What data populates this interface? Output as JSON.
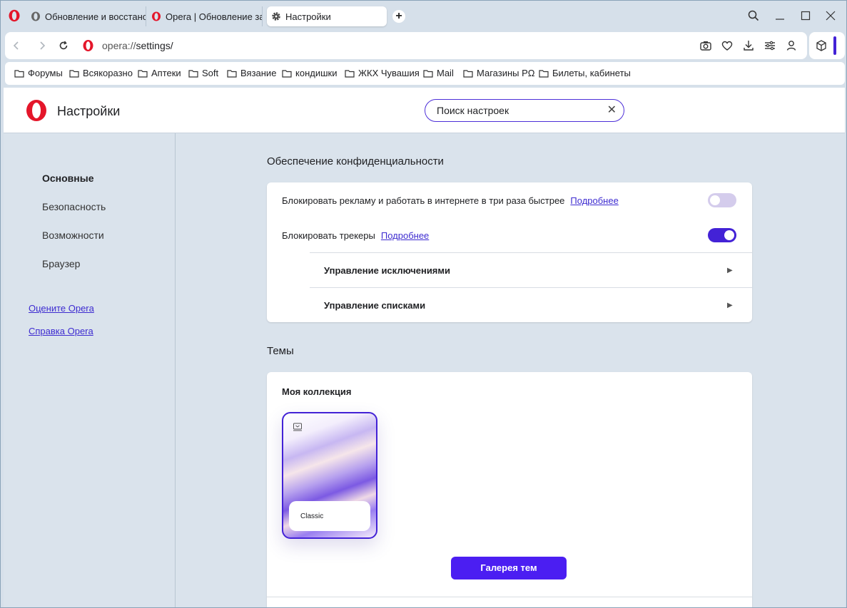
{
  "tabs": [
    {
      "title": "Обновление и восстанов",
      "icon": "opera-gray-icon"
    },
    {
      "title": "Opera | Обновление зав",
      "icon": "opera-red-icon"
    },
    {
      "title": "Настройки",
      "icon": "gear-icon",
      "active": true
    }
  ],
  "window_controls": {
    "search": "⌕",
    "minimize": "—",
    "maximize": "☐",
    "close": "✕"
  },
  "address": {
    "url_host": "opera://",
    "url_path": "settings/"
  },
  "bookmarks": [
    "Форумы",
    "Всякоразно",
    "Аптеки",
    "Soft",
    "Вязание",
    "кондишки",
    "ЖКХ Чувашия",
    "Mail",
    "Магазины РΩ",
    "Билеты, кабинеты"
  ],
  "header": {
    "title": "Настройки",
    "search_value": "Поиск настроек",
    "clear": "✕"
  },
  "sidebar": {
    "items": [
      {
        "label": "Основные",
        "active": true
      },
      {
        "label": "Безопасность"
      },
      {
        "label": "Возможности"
      },
      {
        "label": "Браузер"
      }
    ],
    "links": [
      "Оцените Opera",
      "Справка Opera"
    ]
  },
  "privacy": {
    "title": "Обеспечение конфиденциальности",
    "ads": {
      "label": "Блокировать рекламу и работать в интернете в три раза быстрее",
      "link": "Подробнее",
      "enabled": false
    },
    "trackers": {
      "label": "Блокировать трекеры",
      "link": "Подробнее",
      "enabled": true
    },
    "exceptions": "Управление исключениями",
    "lists": "Управление списками"
  },
  "themes": {
    "title": "Темы",
    "collection_title": "Моя коллекция",
    "theme_name": "Classic",
    "gallery_button": "Галерея тем"
  },
  "colors": {
    "accent": "#4322d6",
    "button": "#4b1ef2",
    "link": "#3d2bd0",
    "opera_red": "#e4162a"
  }
}
